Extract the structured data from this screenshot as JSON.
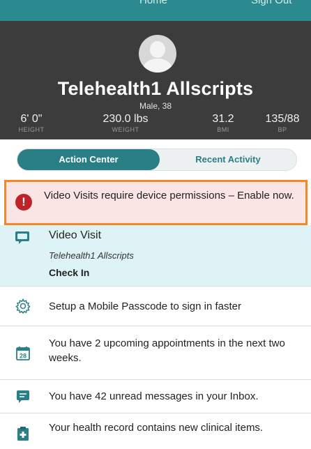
{
  "topbar": {
    "clipped_left": "Home",
    "clipped_right": "Sign Out"
  },
  "profile": {
    "name": "Telehealth1 Allscripts",
    "subtitle": "Male, 38",
    "vitals": [
      {
        "value": "6' 0\"",
        "label": "HEIGHT"
      },
      {
        "value": "230.0 lbs",
        "label": "WEIGHT"
      },
      {
        "value": "31.2",
        "label": "BMI"
      },
      {
        "value": "135/88",
        "label": "BP"
      }
    ]
  },
  "segment": {
    "active": "Action Center",
    "inactive": "Recent Activity"
  },
  "alert": {
    "icon": "exclamation-icon",
    "text": "Video Visits require device permissions – Enable now."
  },
  "video_visit": {
    "icon": "video-chat-icon",
    "title": "Video Visit",
    "patient": "Telehealth1 Allscripts",
    "action": "Check In"
  },
  "actions": [
    {
      "icon": "gear-icon",
      "text": "Setup a Mobile Passcode to sign in faster"
    },
    {
      "icon": "calendar-icon",
      "calendar_day": "28",
      "text": "You have 2 upcoming appointments in the next two weeks."
    },
    {
      "icon": "message-icon",
      "text": "You have 42 unread messages in your Inbox."
    },
    {
      "icon": "clipboard-icon",
      "text": "Your health record contains new clinical items."
    }
  ],
  "colors": {
    "teal": "#2a7f86",
    "header_dark": "#3c3c3c",
    "alert_bg": "#fbe4e4",
    "alert_border": "#ef8a2b",
    "alert_icon": "#c0222a",
    "video_bg": "#ddf3f5"
  }
}
